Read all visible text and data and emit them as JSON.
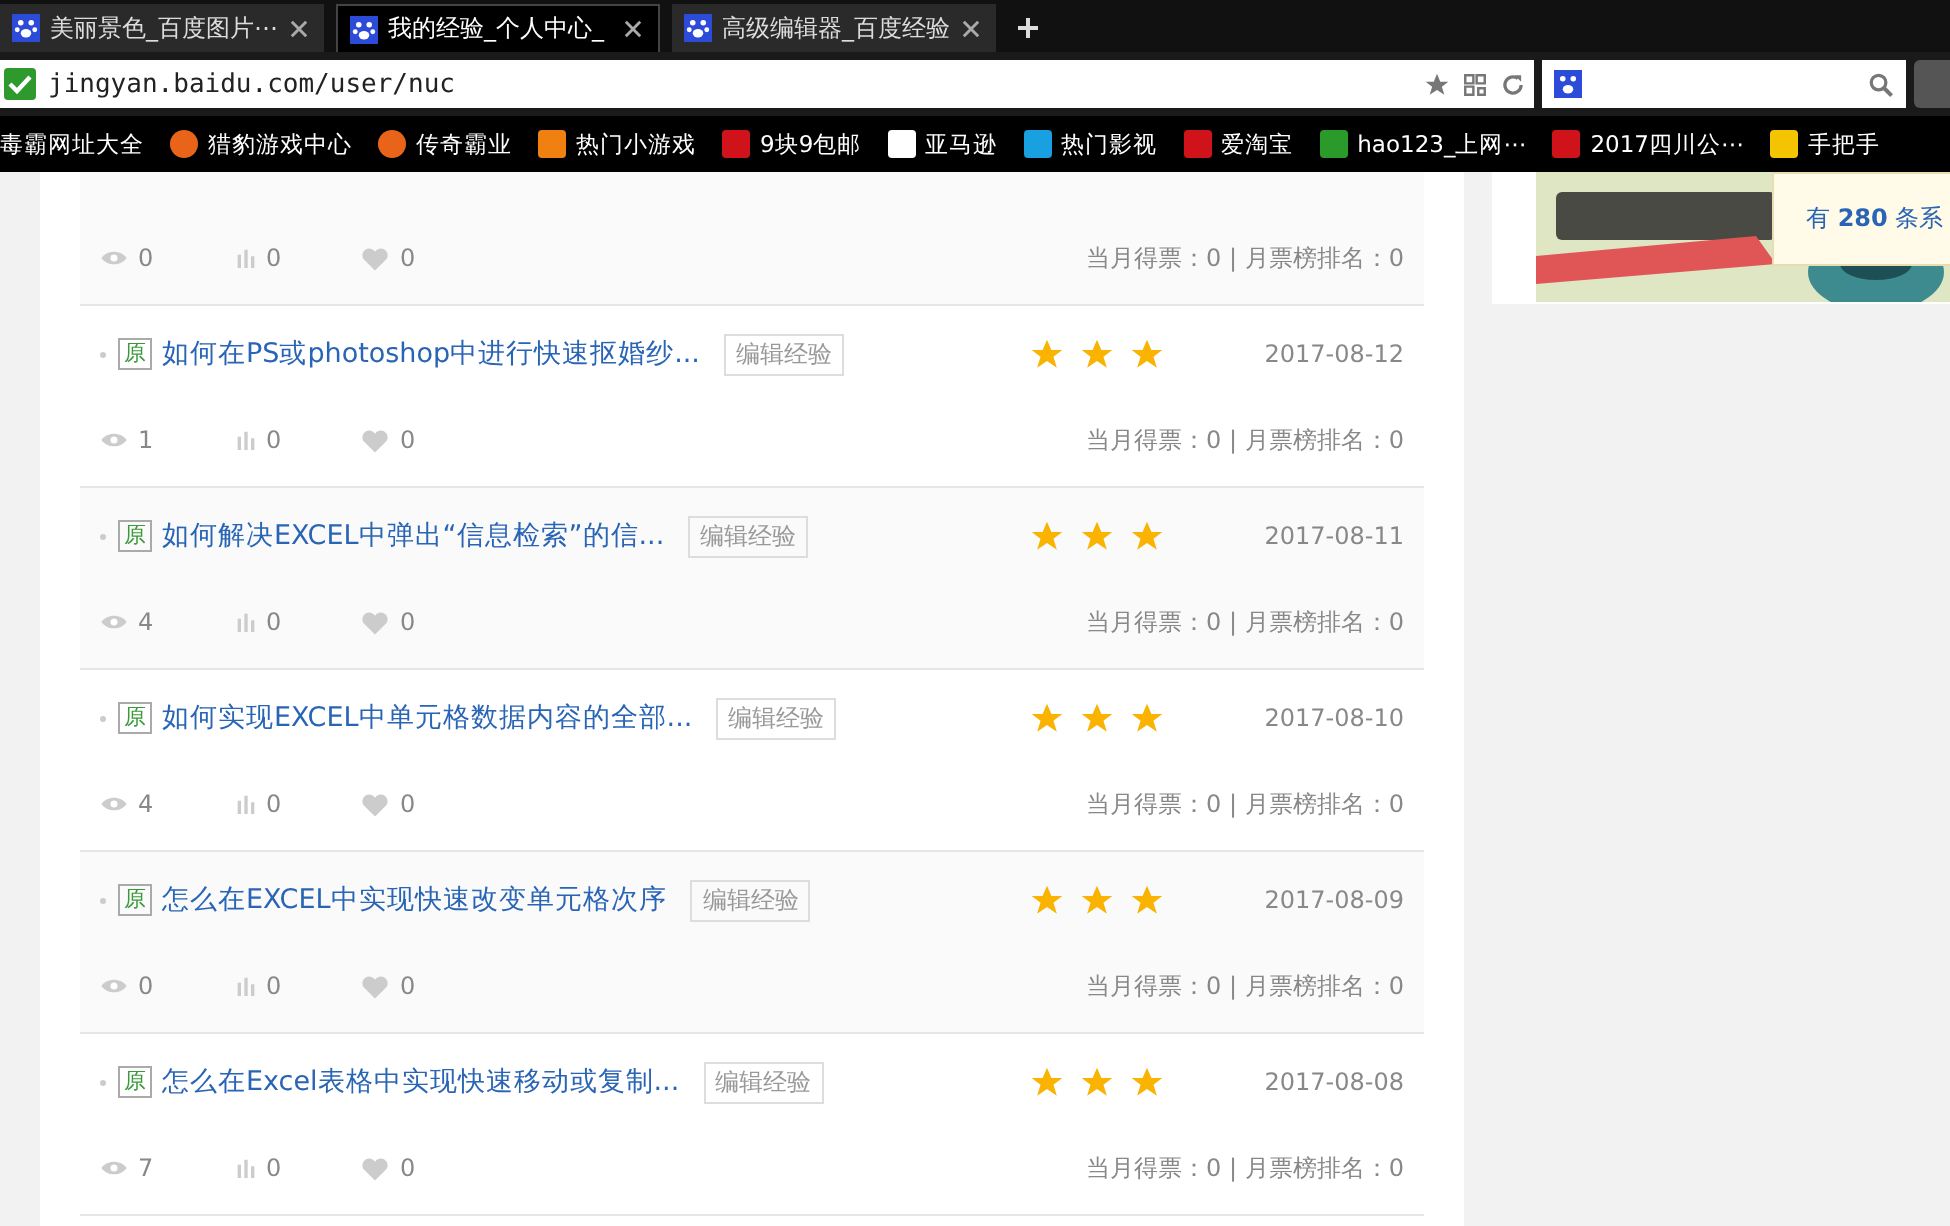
{
  "tabs": [
    {
      "label": "美丽景色_百度图片⋯",
      "selected": false
    },
    {
      "label": "我的经验_个人中心_",
      "selected": true
    },
    {
      "label": "高级编辑器_百度经验",
      "selected": false
    }
  ],
  "address": {
    "url": "jingyan.baidu.com/user/nuc"
  },
  "bookmarks": [
    {
      "label": "毒霸网址大全",
      "kind": "plain"
    },
    {
      "label": "猎豹游戏中心",
      "kind": "k"
    },
    {
      "label": "传奇霸业",
      "kind": "k"
    },
    {
      "label": "热门小游戏",
      "kind": "orange"
    },
    {
      "label": "9块9包邮",
      "kind": "red"
    },
    {
      "label": "亚马逊",
      "kind": "amazon"
    },
    {
      "label": "热门影视",
      "kind": "play"
    },
    {
      "label": "爱淘宝",
      "kind": "red"
    },
    {
      "label": "hao123_上网⋯",
      "kind": "hao"
    },
    {
      "label": "2017四川公⋯",
      "kind": "red"
    },
    {
      "label": "手把手",
      "kind": "s"
    }
  ],
  "items": [
    {
      "views": "0",
      "reads": "0",
      "likes": "0",
      "votes": "当月得票：0 | 月票榜排名：0"
    },
    {
      "badge": "原",
      "title": "如何在PS或photoshop中进行快速抠婚纱...",
      "tag": "编辑经验",
      "stars": 3,
      "date": "2017-08-12",
      "views": "1",
      "reads": "0",
      "likes": "0",
      "votes": "当月得票：0 | 月票榜排名：0"
    },
    {
      "badge": "原",
      "title": "如何解决EXCEL中弹出“信息检索”的信...",
      "tag": "编辑经验",
      "stars": 3,
      "date": "2017-08-11",
      "views": "4",
      "reads": "0",
      "likes": "0",
      "votes": "当月得票：0 | 月票榜排名：0"
    },
    {
      "badge": "原",
      "title": "如何实现EXCEL中单元格数据内容的全部...",
      "tag": "编辑经验",
      "stars": 3,
      "date": "2017-08-10",
      "views": "4",
      "reads": "0",
      "likes": "0",
      "votes": "当月得票：0 | 月票榜排名：0"
    },
    {
      "badge": "原",
      "title": "怎么在EXCEL中实现快速改变单元格次序",
      "tag": "编辑经验",
      "stars": 3,
      "date": "2017-08-09",
      "views": "0",
      "reads": "0",
      "likes": "0",
      "votes": "当月得票：0 | 月票榜排名：0"
    },
    {
      "badge": "原",
      "title": "怎么在Excel表格中实现快速移动或复制...",
      "tag": "编辑经验",
      "stars": 3,
      "date": "2017-08-08",
      "views": "7",
      "reads": "0",
      "likes": "0",
      "votes": "当月得票：0 | 月票榜排名：0"
    }
  ],
  "sidebar": {
    "tooltip": "有 **280** 条系"
  }
}
